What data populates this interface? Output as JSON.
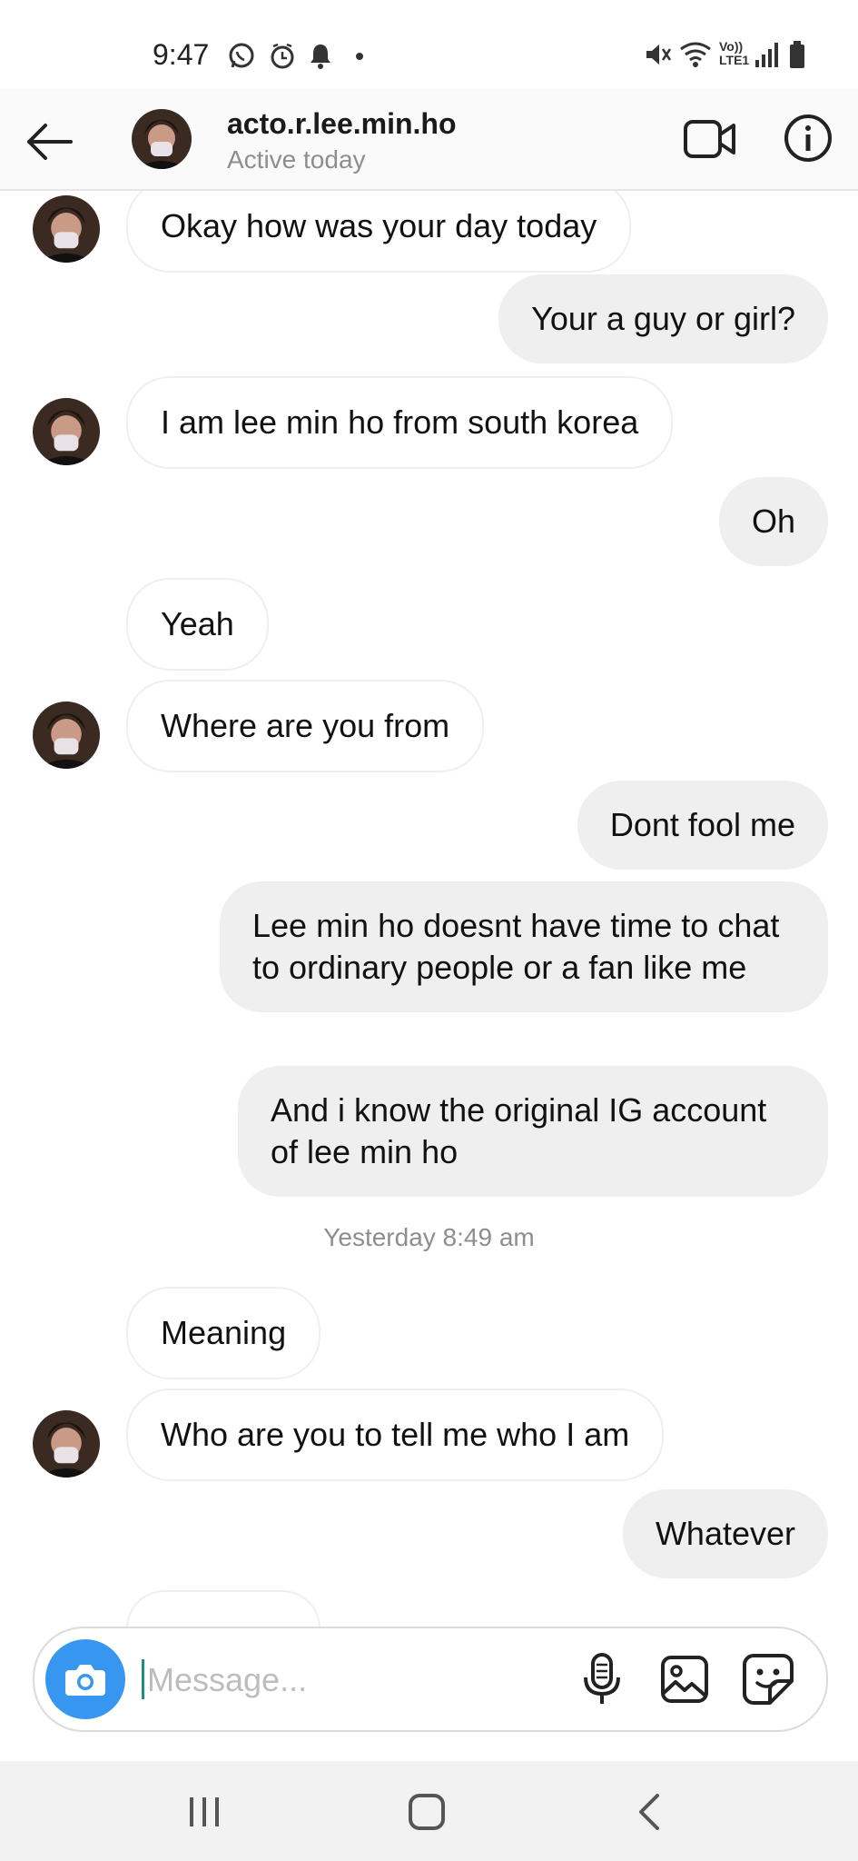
{
  "status_bar": {
    "time": "9:47",
    "left_icons": [
      "whatsapp-icon",
      "alarm-icon",
      "bell-icon",
      "dot-icon"
    ],
    "right_icons": [
      "mute-icon",
      "wifi-icon",
      "volte-icon",
      "signal-icon",
      "battery-icon"
    ],
    "volte_label_top": "Vo))",
    "volte_label_bottom": "LTE1"
  },
  "header": {
    "username": "acto.r.lee.min.ho",
    "status": "Active today"
  },
  "messages": [
    {
      "side": "in",
      "text": "Okay how was your day today",
      "avatar": true
    },
    {
      "side": "out",
      "text": "Your a guy or girl?"
    },
    {
      "side": "in",
      "text": "I am lee min ho from south korea",
      "avatar": true
    },
    {
      "side": "out",
      "text": "Oh"
    },
    {
      "side": "in",
      "text": "Yeah",
      "avatar": false
    },
    {
      "side": "in",
      "text": "Where are you from",
      "avatar": true
    },
    {
      "side": "out",
      "text": "Dont fool me"
    },
    {
      "side": "out",
      "text": "Lee min ho doesnt have time to chat to ordinary people or a fan like me"
    },
    {
      "side": "out",
      "text": "And i know the original IG account of lee min ho"
    },
    {
      "side": "in",
      "text": "Meaning",
      "avatar": false
    },
    {
      "side": "in",
      "text": "Who are you to tell me who I am",
      "avatar": true
    },
    {
      "side": "out",
      "text": "Whatever"
    }
  ],
  "timestamp": "Yesterday 8:49 am",
  "composer": {
    "placeholder": "Message..."
  },
  "colors": {
    "accent": "#3797f0",
    "incoming_bubble": "#ffffff",
    "outgoing_bubble": "#efefef",
    "muted_text": "#8e8e8e"
  }
}
